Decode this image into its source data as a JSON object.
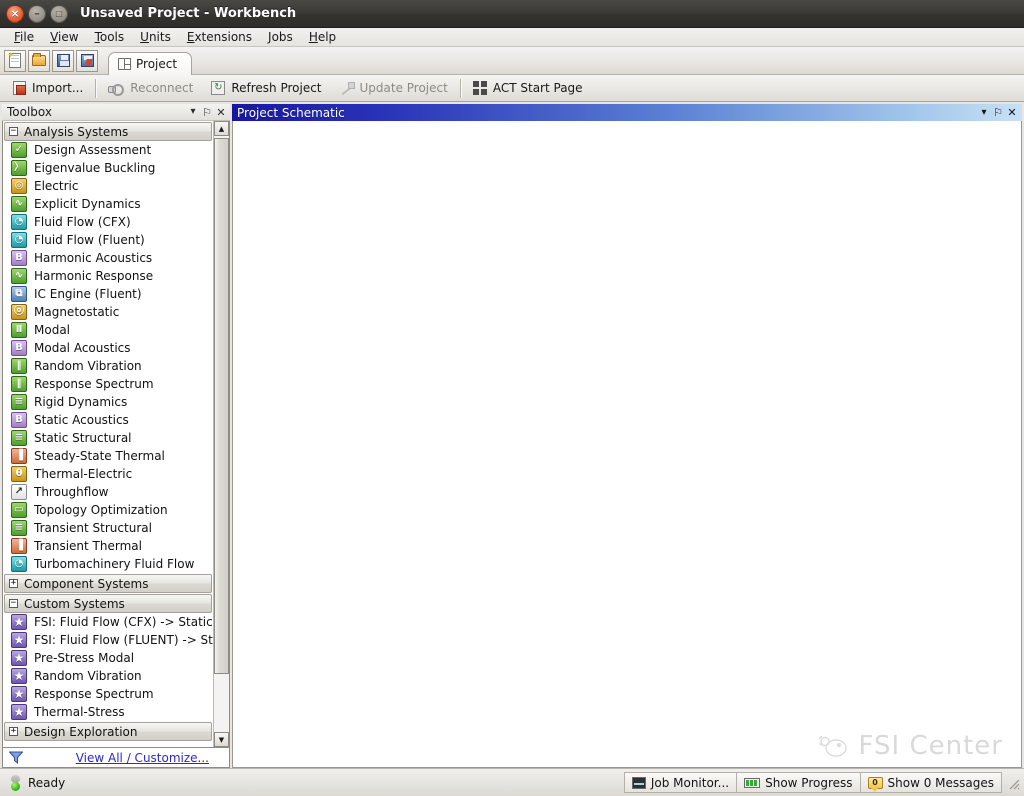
{
  "window": {
    "title": "Unsaved Project - Workbench",
    "controls": [
      {
        "name": "close",
        "glyph": "×"
      },
      {
        "name": "minimize",
        "glyph": "–"
      },
      {
        "name": "maximize",
        "glyph": "□"
      }
    ]
  },
  "menubar": {
    "items": [
      {
        "id": "file",
        "accel": "F",
        "rest": "ile"
      },
      {
        "id": "view",
        "accel": "V",
        "rest": "iew"
      },
      {
        "id": "tools",
        "accel": "T",
        "rest": "ools"
      },
      {
        "id": "units",
        "accel": "U",
        "rest": "nits"
      },
      {
        "id": "extensions",
        "accel": "E",
        "rest": "xtensions"
      },
      {
        "id": "jobs",
        "accel": "J",
        "rest": "obs"
      },
      {
        "id": "help",
        "accel": "H",
        "rest": "elp"
      }
    ]
  },
  "quick_toolbar": {
    "buttons": [
      {
        "name": "new-project",
        "icon": "new-document-icon"
      },
      {
        "name": "open-project",
        "icon": "open-folder-icon"
      },
      {
        "name": "save-project",
        "icon": "save-icon"
      },
      {
        "name": "save-as-project",
        "icon": "save-as-icon"
      }
    ]
  },
  "tabs": [
    {
      "label": "Project",
      "active": true,
      "icon": "project-layout-icon"
    }
  ],
  "toolbar": {
    "import_label": "Import...",
    "reconnect_label": "Reconnect",
    "refresh_label": "Refresh Project",
    "update_label": "Update Project",
    "act_label": "ACT Start Page"
  },
  "toolbox": {
    "title": "Toolbox",
    "header_buttons": [
      {
        "name": "toolbox-menu-button",
        "glyph": "▾"
      },
      {
        "name": "toolbox-pin-button",
        "glyph": "⚐"
      },
      {
        "name": "toolbox-close-button",
        "glyph": "✕"
      }
    ],
    "groups": [
      {
        "name": "Analysis Systems",
        "expanded": true,
        "toggle": "−",
        "items": [
          {
            "label": "Design Assessment",
            "icon": "check-icon",
            "style": "ic-green",
            "glyph": "✓"
          },
          {
            "label": "Eigenvalue Buckling",
            "icon": "buckling-icon",
            "style": "ic-green",
            "glyph": "〉"
          },
          {
            "label": "Electric",
            "icon": "electric-icon",
            "style": "ic-yellow",
            "glyph": "◎"
          },
          {
            "label": "Explicit Dynamics",
            "icon": "waveform-icon",
            "style": "ic-green",
            "glyph": "∿"
          },
          {
            "label": "Fluid Flow (CFX)",
            "icon": "cfx-icon",
            "style": "ic-cyan",
            "glyph": "◔"
          },
          {
            "label": "Fluid Flow (Fluent)",
            "icon": "fluent-icon",
            "style": "ic-cyan",
            "glyph": "◔"
          },
          {
            "label": "Harmonic Acoustics",
            "icon": "acoustics-icon",
            "style": "ic-purple",
            "glyph": "B"
          },
          {
            "label": "Harmonic Response",
            "icon": "harmonic-icon",
            "style": "ic-green",
            "glyph": "∿"
          },
          {
            "label": "IC Engine (Fluent)",
            "icon": "ic-engine-icon",
            "style": "ic-blue",
            "glyph": "⧉"
          },
          {
            "label": "Magnetostatic",
            "icon": "magnet-icon",
            "style": "ic-yellow",
            "glyph": "ⓞ"
          },
          {
            "label": "Modal",
            "icon": "modal-icon",
            "style": "ic-green",
            "glyph": "Ⅱ"
          },
          {
            "label": "Modal Acoustics",
            "icon": "modal-acoustics-icon",
            "style": "ic-purple",
            "glyph": "B"
          },
          {
            "label": "Random Vibration",
            "icon": "bars-icon",
            "style": "ic-green",
            "glyph": "‖"
          },
          {
            "label": "Response Spectrum",
            "icon": "spectrum-icon",
            "style": "ic-green",
            "glyph": "‖"
          },
          {
            "label": "Rigid Dynamics",
            "icon": "rigid-dynamics-icon",
            "style": "ic-green",
            "glyph": "≡"
          },
          {
            "label": "Static Acoustics",
            "icon": "static-acoustics-icon",
            "style": "ic-purple",
            "glyph": "B"
          },
          {
            "label": "Static Structural",
            "icon": "structural-icon",
            "style": "ic-green",
            "glyph": "≡"
          },
          {
            "label": "Steady-State Thermal",
            "icon": "thermometer-icon",
            "style": "ic-red",
            "glyph": "▐"
          },
          {
            "label": "Thermal-Electric",
            "icon": "thermal-electric-icon",
            "style": "ic-yellow",
            "glyph": "θ"
          },
          {
            "label": "Throughflow",
            "icon": "throughflow-icon",
            "style": "ic-white",
            "glyph": "↗"
          },
          {
            "label": "Topology Optimization",
            "icon": "topology-icon",
            "style": "ic-green",
            "glyph": "▭"
          },
          {
            "label": "Transient Structural",
            "icon": "transient-structural-icon",
            "style": "ic-green",
            "glyph": "≡"
          },
          {
            "label": "Transient Thermal",
            "icon": "transient-thermal-icon",
            "style": "ic-red",
            "glyph": "▐"
          },
          {
            "label": "Turbomachinery Fluid Flow",
            "icon": "turbo-icon",
            "style": "ic-cyan",
            "glyph": "◔"
          }
        ]
      },
      {
        "name": "Component Systems",
        "expanded": false,
        "toggle": "+",
        "items": []
      },
      {
        "name": "Custom Systems",
        "expanded": true,
        "toggle": "−",
        "items": [
          {
            "label": "FSI: Fluid Flow (CFX) -> Static St",
            "icon": "star-icon",
            "style": "ic-star",
            "glyph": "★"
          },
          {
            "label": "FSI: Fluid Flow (FLUENT) -> Stati",
            "icon": "star-icon",
            "style": "ic-star",
            "glyph": "★"
          },
          {
            "label": "Pre-Stress Modal",
            "icon": "star-icon",
            "style": "ic-star",
            "glyph": "★"
          },
          {
            "label": "Random Vibration",
            "icon": "star-icon",
            "style": "ic-star",
            "glyph": "★"
          },
          {
            "label": "Response Spectrum",
            "icon": "star-icon",
            "style": "ic-star",
            "glyph": "★"
          },
          {
            "label": "Thermal-Stress",
            "icon": "star-icon",
            "style": "ic-star",
            "glyph": "★"
          }
        ]
      },
      {
        "name": "Design Exploration",
        "expanded": false,
        "toggle": "+",
        "items": []
      }
    ],
    "footer": {
      "filter_icon": "funnel-icon",
      "view_all_label": "View All / Customize..."
    },
    "scrollbar": {
      "up_glyph": "▲",
      "down_glyph": "▼"
    }
  },
  "schematic": {
    "title": "Project Schematic",
    "header_buttons": [
      {
        "name": "schematic-menu-button",
        "glyph": "▾"
      },
      {
        "name": "schematic-pin-button",
        "glyph": "⚐"
      },
      {
        "name": "schematic-close-button",
        "glyph": "✕"
      }
    ],
    "watermark": "FSI Center"
  },
  "statusbar": {
    "status": "Ready",
    "job_monitor_label": "Job Monitor...",
    "show_progress_label": "Show Progress",
    "show_messages_label": "Show 0 Messages"
  },
  "colors": {
    "schematic_header_start": "#17179e",
    "schematic_header_end": "#c7e0f5",
    "link": "#2a2ad0",
    "status_ok": "#2fbe18",
    "titlebar": "#3c3a36"
  }
}
